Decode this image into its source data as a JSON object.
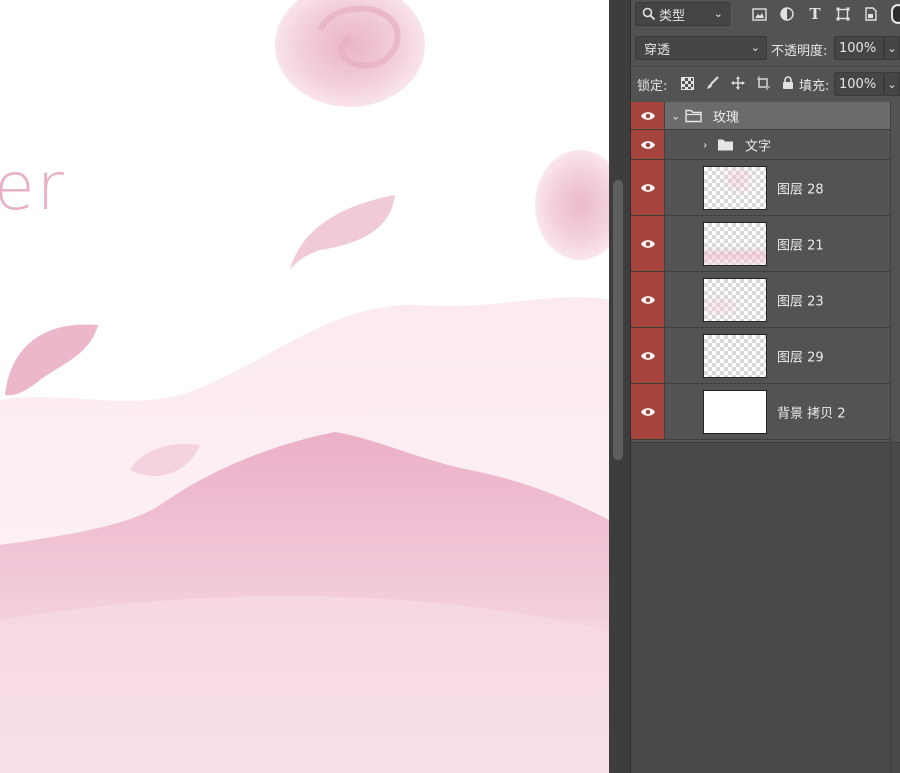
{
  "canvas": {
    "visible_text": "er"
  },
  "panel": {
    "filter": {
      "kind_label": "类型",
      "icons": [
        "image-filter-icon",
        "adjustment-filter-icon",
        "type-filter-icon",
        "shape-filter-icon",
        "smart-object-filter-icon"
      ]
    },
    "blend": {
      "mode": "穿透",
      "opacity_label": "不透明度:",
      "opacity_value": "100%"
    },
    "lock": {
      "label": "锁定:",
      "fill_label": "填充:",
      "fill_value": "100%"
    },
    "layers": [
      {
        "name": "玫瑰",
        "type": "group",
        "expanded": true,
        "visible": true
      },
      {
        "name": "文字",
        "type": "group",
        "expanded": false,
        "visible": true
      },
      {
        "name": "图层 28",
        "type": "layer",
        "visible": true
      },
      {
        "name": "图层 21",
        "type": "layer",
        "visible": true
      },
      {
        "name": "图层 23",
        "type": "layer",
        "visible": true
      },
      {
        "name": "图层 29",
        "type": "layer",
        "visible": true
      },
      {
        "name": "背景 拷贝 2",
        "type": "layer",
        "visible": true
      }
    ]
  },
  "colors": {
    "eye_column": "#a5453e",
    "panel_bg": "#535353",
    "selected_row": "#6b6b6b",
    "canvas_pink": "#e7b2c8"
  }
}
